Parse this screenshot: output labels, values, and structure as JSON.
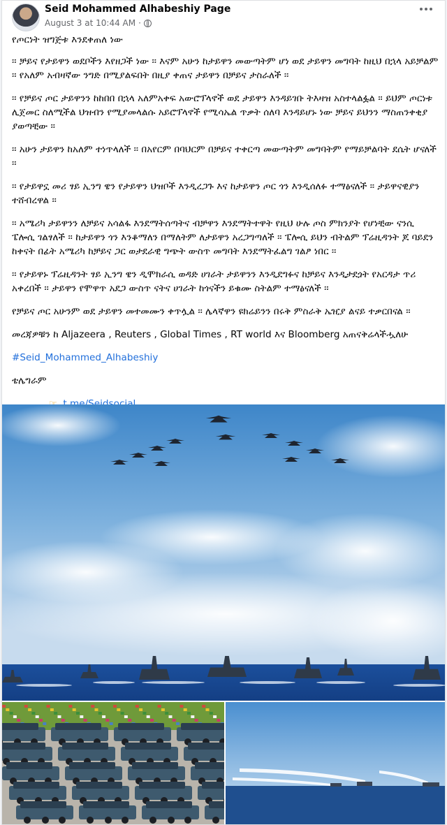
{
  "post": {
    "page_name": "Seid Mohammed Alhabeshiy Page",
    "timestamp": "August 3 at 10:44 AM",
    "separator": "·",
    "privacy_icon": "globe-icon",
    "more_icon": "ellipsis-icon"
  },
  "body": {
    "title": "የጦርነት ዝግጅቱ እንደቀጠለ ነው",
    "paragraphs": [
      "፡፡ ቻይና የታይዋን ወደቦችን እየዘጋች ነው ፡፡ እናም አሁን ከታይዋን መውጣትም ሆነ ወደ ታይዋን መግባት ከዚህ በኋላ አይቻልም ፡፡ የአለም አብዛኛው ንግድ በሚያልፍበት በዚያ ቀጠና ታይዋን በቻይና ታስራለች ፡፡",
      "፡፡ የቻይና ጦር ታይዋንን ከከበበ በኋላ አለምአቀፍ  አውሮፕላኖች ወደ ታይዋን እንዳይገቡ ትእዛዝ አስተላልፏል ፡፡ ይህም ጦርነቱ ሊጀመር ስለሚችል ህዝብን የሚያመላልሱ አይሮፕላኖች የሚሳኤል ጥቃት ሰለባ እንዳይሆኑ ነው ቻይና ይህንን ማስጠንቀቂያ ያወጣቺው ፡፡",
      "፡፡ አሁን ታይዋን ከአለም ተነጥላለች ፡፡ በአየርም በባህርም በቻይና ተቀርጣ መውጣትም መግባትም የማይቻልባት ደሴት ሆናለች ፡፡",
      "፡፡ የታይዋኗ መሪ ፃይ ኢንግ ዌን የታይዋን ህዝቦች እንዲረጋጉ እና ከታይዋን ጦር ጎን እንዲሰለፉ ተማፅናለች ፡፡ ታይዋናዊያን ተሸብረዋል ፡፡",
      "፡፡ አሜሪካ ታይዋንን ለቻይና አሳልፋ እንደማትሰጣትና ብቻዋን እንደማትተዋት የዚህ ሁሉ ጦስ ምክንያት የሆነቺው ናንሲ ፔሎሲ ገልፃለች ፡፡ ከታይዋን ጎን እንቆማለን በማለትም ለታይዋን አረጋግጣለች ፡፡ ፔሎሲ ይህን ብትልም ፕሬዚዳንት ጆ ባይደን ከቀናት በፊት አሜሪካ ከቻይና ጋር ወታደራዊ ግጭት ውስጥ መግባት እንደማትፈልግ ገልፆ ነበር ፡፡",
      "፡፡ የታይዋኑ ፕሬዚዳንት ፃይ ኢንግ ዌን ዲሞክራሲ ወዳድ ሀገራት ታይዋንን እንዲደግፉና ከቻይና እንዲታደጏት የአርዳታ ጥሪ አቀረበች ፡፡ ታይዋን የሞዋጥ አደጋ ውስጥ ናትና ሀገራት ከጎናችን ይቁሙ ስትልም ተማፅናለች ፡፡",
      "የቻይና ጦር አሁንም ወደ ታይዋን መተመሙን ቀጥሏል ፡፡ ሌላኛዋን ዩክሬይንን በሩቅ ምስራቅ ኤዢያ ልናይ ተቃርበናል ፡፡",
      "መረጃዎቹን ከ Aljazeera , Reuters , Global Times , RT world እና Bloomberg አጠናቅሬላችሗለሁ"
    ],
    "hashtag": "#Seid_Mohammed_Alhabeshiy",
    "telegram_label": "ቴሌግራም",
    "telegram_link": "t.me/Seidsocial",
    "hand_icon": "pointing-hand-icon"
  },
  "photos": {
    "main": "fighter-jets-and-warships-photo",
    "bottom_left": "missile-launcher-trucks-photo",
    "bottom_right": "missile-launch-at-sea-photo"
  }
}
